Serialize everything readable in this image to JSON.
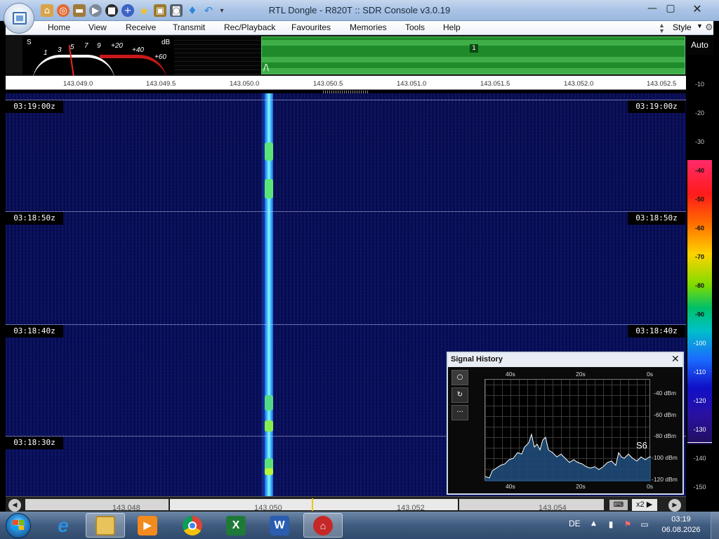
{
  "window": {
    "title": "RTL Dongle - R820T :: SDR Console v3.0.19",
    "controls": {
      "minimize": "—",
      "maximize": "▢",
      "close": "✕"
    }
  },
  "quick_access_icons": [
    "home-icon",
    "lifebuoy-icon",
    "folder-icon",
    "play-icon",
    "stop-icon",
    "add-icon",
    "star-icon",
    "lock-icon",
    "camera-icon",
    "drop-icon",
    "undo-icon",
    "dropdown-icon"
  ],
  "menu": {
    "items": [
      "Home",
      "View",
      "Receive",
      "Transmit",
      "Rec/Playback",
      "Favourites",
      "Memories",
      "Tools",
      "Help"
    ],
    "style_label": "Style"
  },
  "smeter": {
    "s_label": "S",
    "db_label": "dB",
    "scale": [
      "1",
      "3",
      "5",
      "7",
      "9",
      "+20",
      "+40",
      "+60"
    ],
    "needle_value": 5
  },
  "bandscope": {
    "marker": "1",
    "wave_glyph": "/\\"
  },
  "auto_label": "Auto",
  "frequency_scale": [
    "143.049.0",
    "143.049.5",
    "143.050.0",
    "143.050.5",
    "143.051.0",
    "143.051.5",
    "143.052.0",
    "143.052.5"
  ],
  "waterfall": {
    "timestamps": [
      "03:19:00z",
      "03:18:50z",
      "03:18:40z",
      "03:18:30z"
    ]
  },
  "level_scale": [
    "-10",
    "-20",
    "-30",
    "-40",
    "-50",
    "-60",
    "-70",
    "-80",
    "-90",
    "-100",
    "-110",
    "-120",
    "-130",
    "-140",
    "-150"
  ],
  "signal_history": {
    "title": "Signal History",
    "close": "✕",
    "tool_icons": [
      "circle-icon",
      "refresh-icon",
      "more-icon"
    ],
    "tool_glyphs": [
      "○",
      "↻",
      "···"
    ],
    "top_axis": [
      "40s",
      "20s",
      "0s"
    ],
    "bottom_axis": [
      "40s",
      "20s",
      "0s"
    ],
    "dbm_axis": [
      "-40 dBm",
      "-60 dBm",
      "-80 dBm",
      "-100 dBm",
      "-120 dBm"
    ],
    "s_reading": "S6"
  },
  "bottom_bar": {
    "frequencies": [
      "143.048",
      "143.050",
      "143.052",
      "143.054"
    ],
    "zoom": "x2",
    "zoom_arrow": "▶",
    "nav_left": "◀",
    "nav_right": "▶"
  },
  "taskbar": {
    "apps": [
      "internet-explorer-icon",
      "file-explorer-icon",
      "media-player-icon",
      "chrome-icon",
      "excel-icon",
      "word-icon",
      "sdr-console-icon"
    ],
    "excel_letter": "X",
    "word_letter": "W",
    "language": "DE",
    "time": "03:19",
    "date": "06.08.2026"
  },
  "colors": {
    "accent": "#1b4fd0",
    "signal": "#3ec6ff",
    "waterfall_bg": "#0a0f5a",
    "bandscope_green": "#1f8a2a"
  }
}
